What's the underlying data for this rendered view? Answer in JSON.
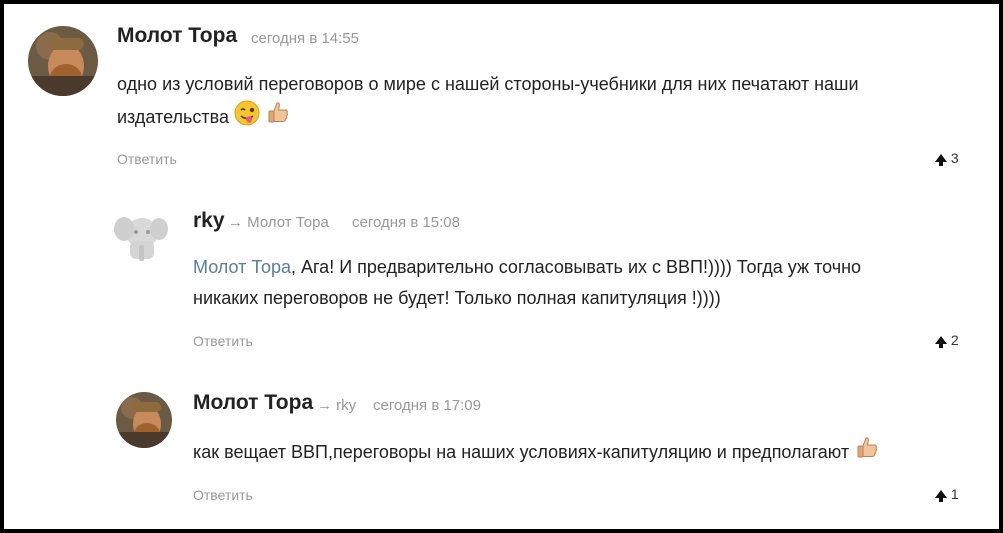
{
  "comments": [
    {
      "author": "Молот Тора",
      "time": "сегодня в 14:55",
      "line1": "одно из условий переговоров о мире с нашей стороны-учебники для них печатают наши",
      "line2": "издательства",
      "emoji1": "winking-tongue-emoji",
      "emoji2": "thumbs-up-emoji",
      "reply_label": "Ответить",
      "votes": "3"
    },
    {
      "author": "rky",
      "to": "Молот Тора",
      "time": "сегодня в 15:08",
      "mention": "Молот Тора",
      "line1_rest": ", Ага! И предварительно согласовывать их с ВВП!)))) Тогда уж точно",
      "line2": "никаких переговоров не будет! Только полная капитуляция !))))",
      "reply_label": "Ответить",
      "votes": "2"
    },
    {
      "author": "Молот Тора",
      "to": "rky",
      "time": "сегодня в 17:09",
      "line1": "как вещает ВВП,переговоры на наших условиях-капитуляцию и предполагают",
      "emoji": "thumbs-up-emoji",
      "reply_label": "Ответить",
      "votes": "1"
    }
  ],
  "arrow_symbol": "→",
  "colors": {
    "text": "#222222",
    "muted": "#999999",
    "mention": "#5a7d9a",
    "frame": "#000000"
  }
}
